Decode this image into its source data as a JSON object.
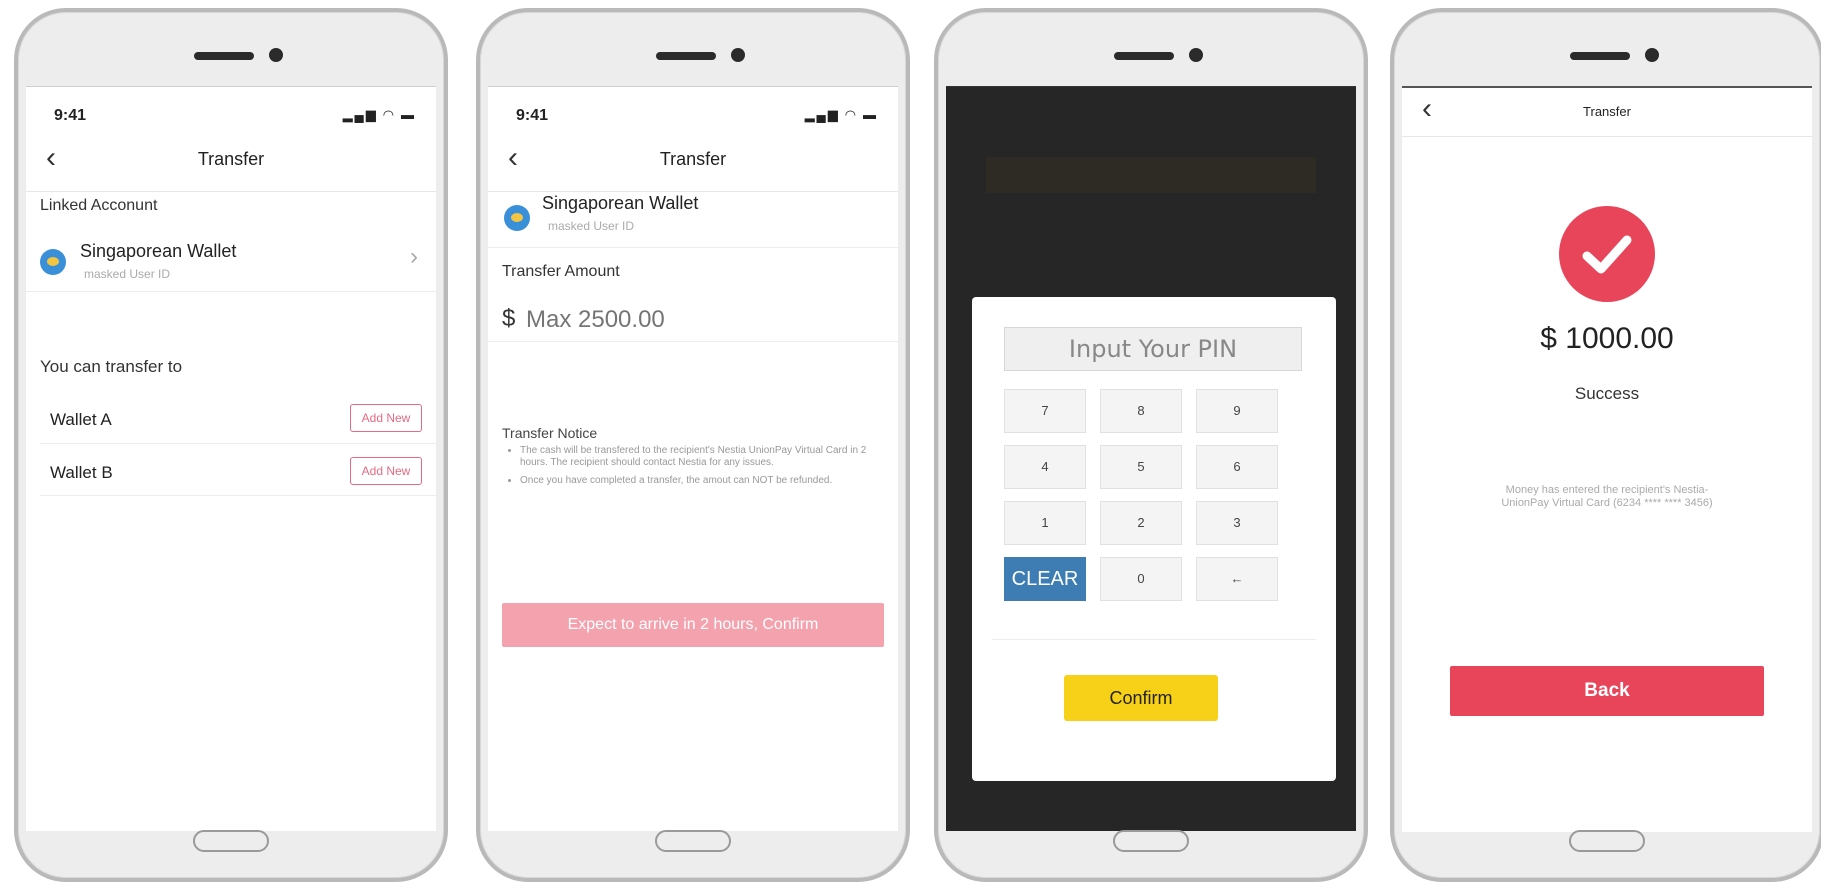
{
  "screen1": {
    "status_time": "9:41",
    "status_icons": "▂▄▆ ◠ ▬",
    "nav_title": "Transfer",
    "linked_label": "Linked Acconunt",
    "wallet_name": "Singaporean Wallet",
    "wallet_sub": "masked User ID",
    "chevron": "›",
    "transfer_to_label": "You can transfer to",
    "targets": [
      {
        "name": "Wallet A",
        "button": "Add New"
      },
      {
        "name": "Wallet B",
        "button": "Add New"
      }
    ]
  },
  "screen2": {
    "status_time": "9:41",
    "status_icons": "▂▄▆ ◠ ▬",
    "nav_title": "Transfer",
    "wallet_name": "Singaporean Wallet",
    "wallet_sub": "masked User ID",
    "amount_label": "Transfer Amount",
    "currency": "$",
    "amount_placeholder": "Max 2500.00",
    "notice_title": "Transfer Notice",
    "notices": [
      "The cash will be transfered to the recipient's Nestia UnionPay Virtual Card in 2 hours. The recipient should contact Nestia for any issues.",
      "Once you have completed a transfer, the amout can NOT be refunded."
    ],
    "confirm_label": "Expect to arrive in 2 hours, Confirm"
  },
  "screen3": {
    "pin_placeholder": "Input Your PIN",
    "keys": [
      "7",
      "8",
      "9",
      "4",
      "5",
      "6",
      "1",
      "2",
      "3",
      "CLEAR",
      "0",
      "←"
    ],
    "confirm_label": "Confirm"
  },
  "screen4": {
    "nav_title": "Transfer",
    "amount": "$ 1000.00",
    "status": "Success",
    "message": "Money has entered the recipient's Nestia-UnionPay Virtual Card (6234 **** **** 3456)",
    "back_label": "Back"
  },
  "colors": {
    "accent_red": "#e8455a",
    "accent_pink_disabled": "#f4a3ae",
    "confirm_yellow": "#f7d117",
    "clear_blue": "#3d7db3"
  }
}
